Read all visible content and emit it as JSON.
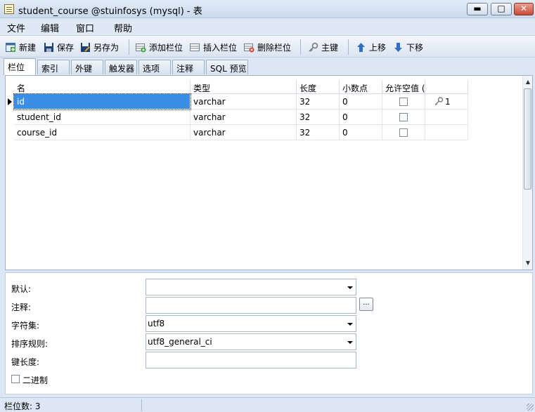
{
  "window": {
    "title": "student_course @stuinfosys (mysql) - 表"
  },
  "menu": [
    "文件",
    "编辑",
    "窗口",
    "帮助"
  ],
  "toolbar": {
    "new": "新建",
    "save": "保存",
    "save_as": "另存为",
    "add_field": "添加栏位",
    "insert_field": "插入栏位",
    "delete_field": "删除栏位",
    "primary_key": "主键",
    "move_up": "上移",
    "move_down": "下移"
  },
  "tabs": [
    "栏位",
    "索引",
    "外键",
    "触发器",
    "选项",
    "注释",
    "SQL 预览"
  ],
  "grid": {
    "columns": [
      "名",
      "类型",
      "长度",
      "小数点",
      "允许空值 (",
      ""
    ],
    "rows": [
      {
        "name": "id",
        "type": "varchar",
        "length": "32",
        "decimals": "0",
        "nullable": false,
        "key": "1"
      },
      {
        "name": "student_id",
        "type": "varchar",
        "length": "32",
        "decimals": "0",
        "nullable": false,
        "key": ""
      },
      {
        "name": "course_id",
        "type": "varchar",
        "length": "32",
        "decimals": "0",
        "nullable": false,
        "key": ""
      }
    ]
  },
  "props": {
    "default_label": "默认:",
    "default_value": "",
    "comment_label": "注释:",
    "comment_value": "",
    "dots": "...",
    "charset_label": "字符集:",
    "charset_value": "utf8",
    "collation_label": "排序规则:",
    "collation_value": "utf8_general_ci",
    "keylen_label": "键长度:",
    "keylen_value": "",
    "binary_label": "二进制"
  },
  "status": {
    "field_count": "栏位数: 3"
  },
  "colors": {
    "selection": "#3a8ee6",
    "background": "#dce6f4"
  }
}
